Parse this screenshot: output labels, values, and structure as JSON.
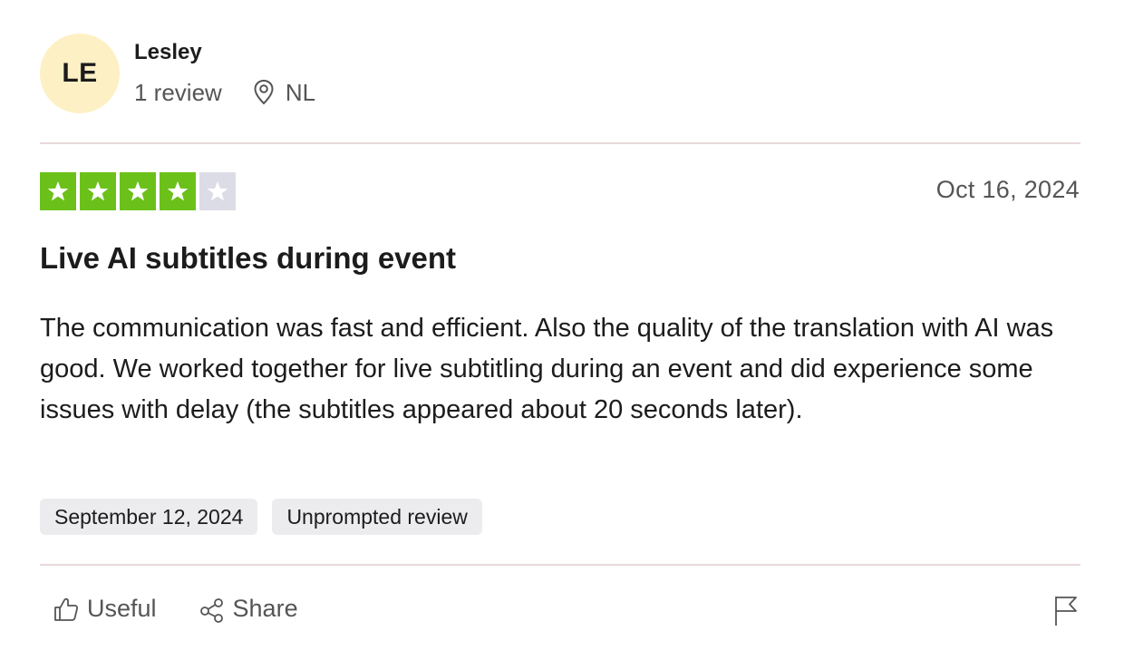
{
  "reviewer": {
    "initials": "LE",
    "name": "Lesley",
    "review_count": "1 review",
    "country": "NL",
    "avatar_color": "#fdf0c4"
  },
  "rating": {
    "value": 4,
    "max": 5,
    "filled_color": "#6bc11a",
    "empty_color": "#dcdce6"
  },
  "review": {
    "date": "Oct 16, 2024",
    "title": "Live AI subtitles during event",
    "body": "The communication was fast and efficient. Also the quality of the translation with AI was good. We worked together for live subtitling during an event and did experience some issues with delay (the subtitles appeared about 20 seconds later)."
  },
  "tags": [
    "September 12, 2024",
    "Unprompted review"
  ],
  "actions": {
    "useful_label": "Useful",
    "share_label": "Share",
    "useful_icon": "thumbs-up-icon",
    "share_icon": "share-icon",
    "flag_icon": "flag-icon",
    "location_icon": "location-pin-icon"
  }
}
